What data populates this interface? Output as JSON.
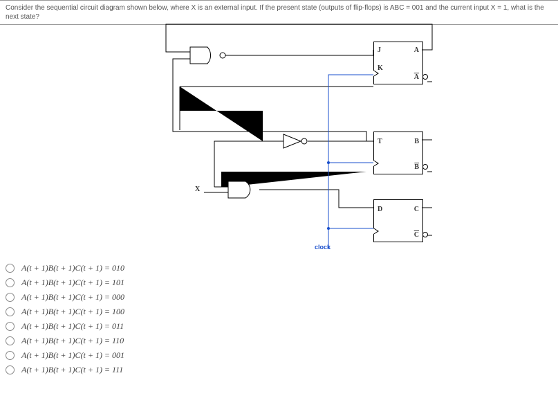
{
  "question": "Consider the sequential circuit diagram shown below, where X is an external input. If the present state (outputs of flip-flops) is ABC = 001 and the current input X = 1, what is the next state?",
  "labels": {
    "x": "X",
    "clock": "clock",
    "ffA": {
      "in1": "J",
      "in2": "K",
      "out": "A",
      "outbar": "A"
    },
    "ffB": {
      "in1": "T",
      "out": "B",
      "outbar": "B"
    },
    "ffC": {
      "in1": "D",
      "out": "C",
      "outbar": "C"
    }
  },
  "options": [
    "A(t + 1)B(t + 1)C(t + 1) = 010",
    "A(t + 1)B(t + 1)C(t + 1) = 101",
    "A(t + 1)B(t + 1)C(t + 1) = 000",
    "A(t + 1)B(t + 1)C(t + 1) = 100",
    "A(t + 1)B(t + 1)C(t + 1) = 011",
    "A(t + 1)B(t + 1)C(t + 1) = 110",
    "A(t + 1)B(t + 1)C(t + 1) = 001",
    "A(t + 1)B(t + 1)C(t + 1) = 111"
  ]
}
